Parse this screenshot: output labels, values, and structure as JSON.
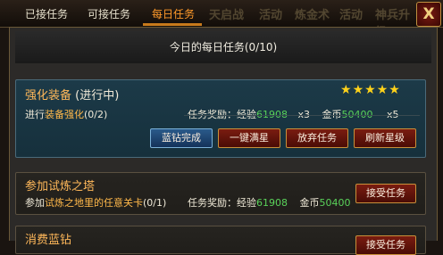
{
  "tabs": [
    {
      "label": "已接任务"
    },
    {
      "label": "可接任务"
    },
    {
      "label": "每日任务"
    }
  ],
  "background_labels": [
    "天启战",
    "活动",
    "炼金术",
    "活动",
    "神兵升级"
  ],
  "close_label": "X",
  "header": {
    "text": "今日的每日任务(0/10)"
  },
  "quests": [
    {
      "title": "强化装备",
      "status": "(进行中)",
      "progress_prefix": "进行",
      "progress_target": "装备强化",
      "progress_count": "(0/2)",
      "reward_label": "任务奖励：经验",
      "exp": "61908",
      "exp_mult": "x3",
      "gold_label": "金币",
      "gold": "50400",
      "gold_mult": "x5",
      "stars": 5,
      "buttons": [
        "蓝钻完成",
        "一键满星",
        "放弃任务",
        "刷新星级"
      ]
    },
    {
      "title": "参加试炼之塔",
      "progress_prefix": "参加",
      "progress_target": "试炼之地里的任意关卡",
      "progress_count": "(0/1)",
      "reward_label": "任务奖励：经验",
      "exp": "61908",
      "gold_label": "金币",
      "gold": "50400",
      "buttons": [
        "接受任务"
      ]
    },
    {
      "title": "消费蓝钻",
      "buttons": [
        "接受任务"
      ]
    }
  ],
  "colors": {
    "accent": "#ff9a2a",
    "title": "#ffb85a",
    "number": "#5ad25a",
    "button": "#7a1c10",
    "blue_button": "#2a5a8a"
  }
}
